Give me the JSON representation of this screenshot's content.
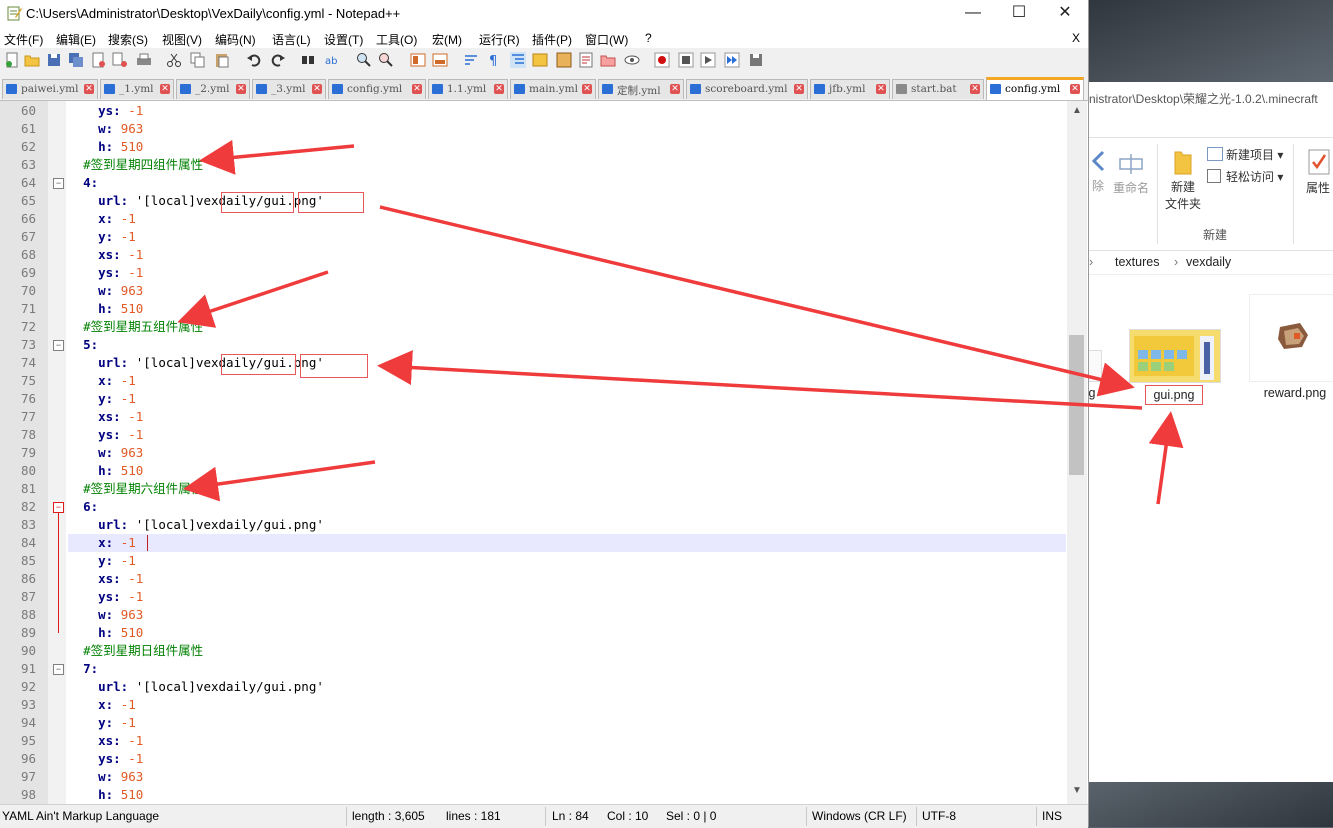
{
  "window": {
    "title": "C:\\Users\\Administrator\\Desktop\\VexDaily\\config.yml - Notepad++",
    "minimize": "—",
    "maximize": "☐",
    "close": "✕",
    "menu_close": "X"
  },
  "menu": [
    "文件(F)",
    "编辑(E)",
    "搜索(S)",
    "视图(V)",
    "编码(N)",
    "语言(L)",
    "设置(T)",
    "工具(O)",
    "宏(M)",
    "运行(R)",
    "插件(P)",
    "窗口(W)",
    "?"
  ],
  "tabs": [
    {
      "label": "paiwei.yml",
      "active": false
    },
    {
      "label": "_1.yml",
      "active": false
    },
    {
      "label": "_2.yml",
      "active": false
    },
    {
      "label": "_3.yml",
      "active": false
    },
    {
      "label": "config.yml",
      "active": false
    },
    {
      "label": "1.1.yml",
      "active": false
    },
    {
      "label": "main.yml",
      "active": false
    },
    {
      "label": "定制.yml",
      "active": false
    },
    {
      "label": "scoreboard.yml",
      "active": false
    },
    {
      "label": "jfb.yml",
      "active": false
    },
    {
      "label": "start.bat",
      "active": false
    },
    {
      "label": "config.yml",
      "active": true
    }
  ],
  "editor": {
    "current_line": 84,
    "lines": [
      {
        "n": "60",
        "indent": "    ",
        "key": "ys:",
        "val": " -1"
      },
      {
        "n": "61",
        "indent": "    ",
        "key": "w:",
        "val": " 963"
      },
      {
        "n": "62",
        "indent": "    ",
        "key": "h:",
        "val": " 510"
      },
      {
        "n": "63",
        "indent": "  ",
        "comment": "#签到星期四组件属性"
      },
      {
        "n": "64",
        "indent": "  ",
        "key": "4:",
        "val": ""
      },
      {
        "n": "65",
        "indent": "    ",
        "key": "url:",
        "str": " '[local]vexdaily/gui.png'"
      },
      {
        "n": "66",
        "indent": "    ",
        "key": "x:",
        "val": " -1"
      },
      {
        "n": "67",
        "indent": "    ",
        "key": "y:",
        "val": " -1"
      },
      {
        "n": "68",
        "indent": "    ",
        "key": "xs:",
        "val": " -1"
      },
      {
        "n": "69",
        "indent": "    ",
        "key": "ys:",
        "val": " -1"
      },
      {
        "n": "70",
        "indent": "    ",
        "key": "w:",
        "val": " 963"
      },
      {
        "n": "71",
        "indent": "    ",
        "key": "h:",
        "val": " 510"
      },
      {
        "n": "72",
        "indent": "  ",
        "comment": "#签到星期五组件属性"
      },
      {
        "n": "73",
        "indent": "  ",
        "key": "5:",
        "val": ""
      },
      {
        "n": "74",
        "indent": "    ",
        "key": "url:",
        "str": " '[local]vexdaily/gui.png'"
      },
      {
        "n": "75",
        "indent": "    ",
        "key": "x:",
        "val": " -1"
      },
      {
        "n": "76",
        "indent": "    ",
        "key": "y:",
        "val": " -1"
      },
      {
        "n": "77",
        "indent": "    ",
        "key": "xs:",
        "val": " -1"
      },
      {
        "n": "78",
        "indent": "    ",
        "key": "ys:",
        "val": " -1"
      },
      {
        "n": "79",
        "indent": "    ",
        "key": "w:",
        "val": " 963"
      },
      {
        "n": "80",
        "indent": "    ",
        "key": "h:",
        "val": " 510"
      },
      {
        "n": "81",
        "indent": "  ",
        "comment": "#签到星期六组件属性"
      },
      {
        "n": "82",
        "indent": "  ",
        "key": "6:",
        "val": ""
      },
      {
        "n": "83",
        "indent": "    ",
        "key": "url:",
        "str": " '[local]vexdaily/gui.png'"
      },
      {
        "n": "84",
        "indent": "    ",
        "key": "x:",
        "val": " -1"
      },
      {
        "n": "85",
        "indent": "    ",
        "key": "y:",
        "val": " -1"
      },
      {
        "n": "86",
        "indent": "    ",
        "key": "xs:",
        "val": " -1"
      },
      {
        "n": "87",
        "indent": "    ",
        "key": "ys:",
        "val": " -1"
      },
      {
        "n": "88",
        "indent": "    ",
        "key": "w:",
        "val": " 963"
      },
      {
        "n": "89",
        "indent": "    ",
        "key": "h:",
        "val": " 510"
      },
      {
        "n": "90",
        "indent": "  ",
        "comment": "#签到星期日组件属性"
      },
      {
        "n": "91",
        "indent": "  ",
        "key": "7:",
        "val": ""
      },
      {
        "n": "92",
        "indent": "    ",
        "key": "url:",
        "str": " '[local]vexdaily/gui.png'"
      },
      {
        "n": "93",
        "indent": "    ",
        "key": "x:",
        "val": " -1"
      },
      {
        "n": "94",
        "indent": "    ",
        "key": "y:",
        "val": " -1"
      },
      {
        "n": "95",
        "indent": "    ",
        "key": "xs:",
        "val": " -1"
      },
      {
        "n": "96",
        "indent": "    ",
        "key": "ys:",
        "val": " -1"
      },
      {
        "n": "97",
        "indent": "    ",
        "key": "w:",
        "val": " 963"
      },
      {
        "n": "98",
        "indent": "    ",
        "key": "h:",
        "val": " 510"
      }
    ]
  },
  "statusbar": {
    "language": "YAML Ain't Markup Language",
    "length": "length : 3,605",
    "lines": "lines : 181",
    "ln": "Ln : 84",
    "col": "Col : 10",
    "sel": "Sel : 0 | 0",
    "eol": "Windows (CR LF)",
    "encoding": "UTF-8",
    "mode": "INS"
  },
  "explorer": {
    "address": "nistrator\\Desktop\\荣耀之光-1.0.2\\.minecraft",
    "ribbon": {
      "remove": "除",
      "rename": "重命名",
      "new_folder": "新建\n文件夹",
      "new_item": "新建项目 ▾",
      "easy_access": "轻松访问 ▾",
      "group_new": "新建",
      "properties": "属性"
    },
    "breadcrumb": [
      "textures",
      "vexdaily"
    ],
    "files": [
      {
        "name": "gui.png"
      },
      {
        "name": "reward.png"
      }
    ],
    "partial_label": "g"
  },
  "colors": {
    "annotation_arrow": "#ef3b3b",
    "keyword": "#000080",
    "number": "#e05a25",
    "comment": "#008000",
    "current_line": "#e8e8ff",
    "active_tab_accent": "#f5a623"
  }
}
